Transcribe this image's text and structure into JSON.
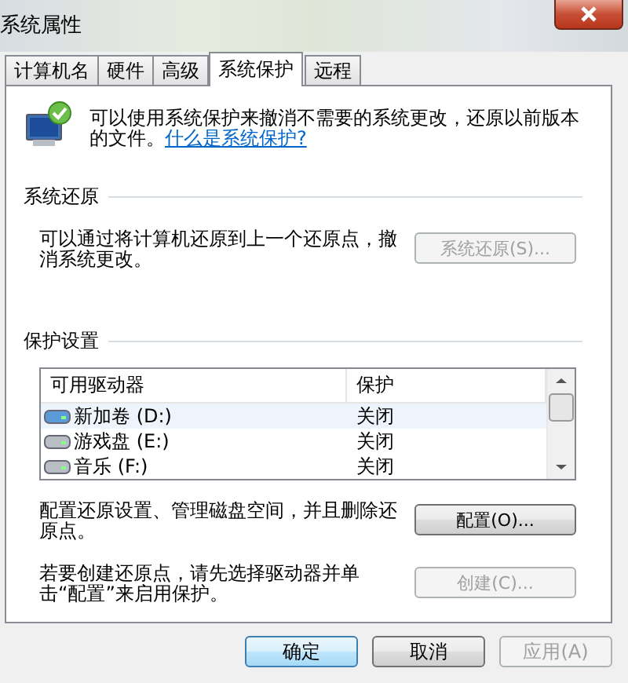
{
  "window": {
    "title": "系统属性"
  },
  "tabs": [
    {
      "label": "计算机名",
      "selected": false
    },
    {
      "label": "硬件",
      "selected": false
    },
    {
      "label": "高级",
      "selected": false
    },
    {
      "label": "系统保护",
      "selected": true
    },
    {
      "label": "远程",
      "selected": false
    }
  ],
  "intro": {
    "text": "可以使用系统保护来撤消不需要的系统更改，还原以前版本的文件。",
    "link": "什么是系统保护?"
  },
  "system_restore": {
    "heading": "系统还原",
    "description": "可以通过将计算机还原到上一个还原点，撤消系统更改。",
    "button": {
      "label": "系统还原(S)...",
      "disabled": true
    }
  },
  "protection_settings": {
    "heading": "保护设置",
    "columns": [
      "可用驱动器",
      "保护"
    ],
    "drives": [
      {
        "name": "新加卷 (D:)",
        "protection": "关闭",
        "selected": true
      },
      {
        "name": "游戏盘 (E:)",
        "protection": "关闭",
        "selected": false
      },
      {
        "name": "音乐 (F:)",
        "protection": "关闭",
        "selected": false
      }
    ],
    "configure": {
      "description": "配置还原设置、管理磁盘空间，并且删除还原点。",
      "button": {
        "label": "配置(O)...",
        "disabled": false
      }
    },
    "create": {
      "description": "若要创建还原点，请先选择驱动器并单击“配置”来启用保护。",
      "button": {
        "label": "创建(C)...",
        "disabled": true
      }
    }
  },
  "buttons": [
    {
      "label": "确定",
      "default": true,
      "disabled": false
    },
    {
      "label": "取消",
      "default": false,
      "disabled": false
    },
    {
      "label": "应用(A)",
      "default": false,
      "disabled": true
    }
  ]
}
